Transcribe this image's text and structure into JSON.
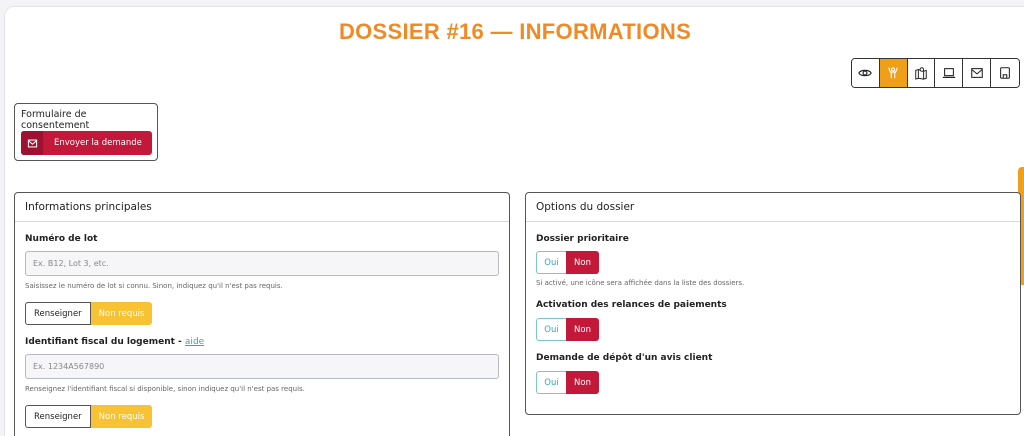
{
  "page": {
    "title": "DOSSIER #16 — INFORMATIONS"
  },
  "toolbar": {
    "buttons": [
      {
        "icon": "eye-icon",
        "active": false
      },
      {
        "icon": "person-raise-hands-icon",
        "active": true
      },
      {
        "icon": "map-pin-icon",
        "active": false
      },
      {
        "icon": "laptop-icon",
        "active": false
      },
      {
        "icon": "mail-icon",
        "active": false
      },
      {
        "icon": "document-icon",
        "active": false
      }
    ],
    "active_color": "#f0a018"
  },
  "consent": {
    "title": "Formulaire de consentement",
    "send_label": "Envoyer la demande",
    "send_icon": "mail-icon",
    "button_color": "#c2183a"
  },
  "main_info": {
    "title": "Informations principales",
    "lot": {
      "label": "Numéro de lot",
      "placeholder": "Ex. B12, Lot 3, etc.",
      "hint": "Saisissez le numéro de lot si connu. Sinon, indiquez qu'il n'est pas requis.",
      "fill_label": "Renseigner",
      "not_required_label": "Non requis"
    },
    "fiscal": {
      "label": "Identifiant fiscal du logement - ",
      "help_link": "aide",
      "placeholder": "Ex. 1234A567890",
      "hint": "Renseignez l'identifiant fiscal si disponible, sinon indiquez qu'il n'est pas requis.",
      "fill_label": "Renseigner",
      "not_required_label": "Non requis"
    }
  },
  "options": {
    "title": "Options du dossier",
    "priority": {
      "label": "Dossier prioritaire",
      "yes": "Oui",
      "no": "Non",
      "selected": "Non",
      "hint": "Si activé, une icône sera affichée dans la liste des dossiers."
    },
    "payment_reminders": {
      "label": "Activation des relances de paiements",
      "yes": "Oui",
      "no": "Non",
      "selected": "Non"
    },
    "client_review": {
      "label": "Demande de dépôt d'un avis client",
      "yes": "Oui",
      "no": "Non",
      "selected": "Non"
    }
  },
  "colors": {
    "accent_orange": "#f08a24",
    "danger_red": "#c2183a",
    "warning_yellow": "#f8c235",
    "link_blue": "#2aa7d9"
  }
}
